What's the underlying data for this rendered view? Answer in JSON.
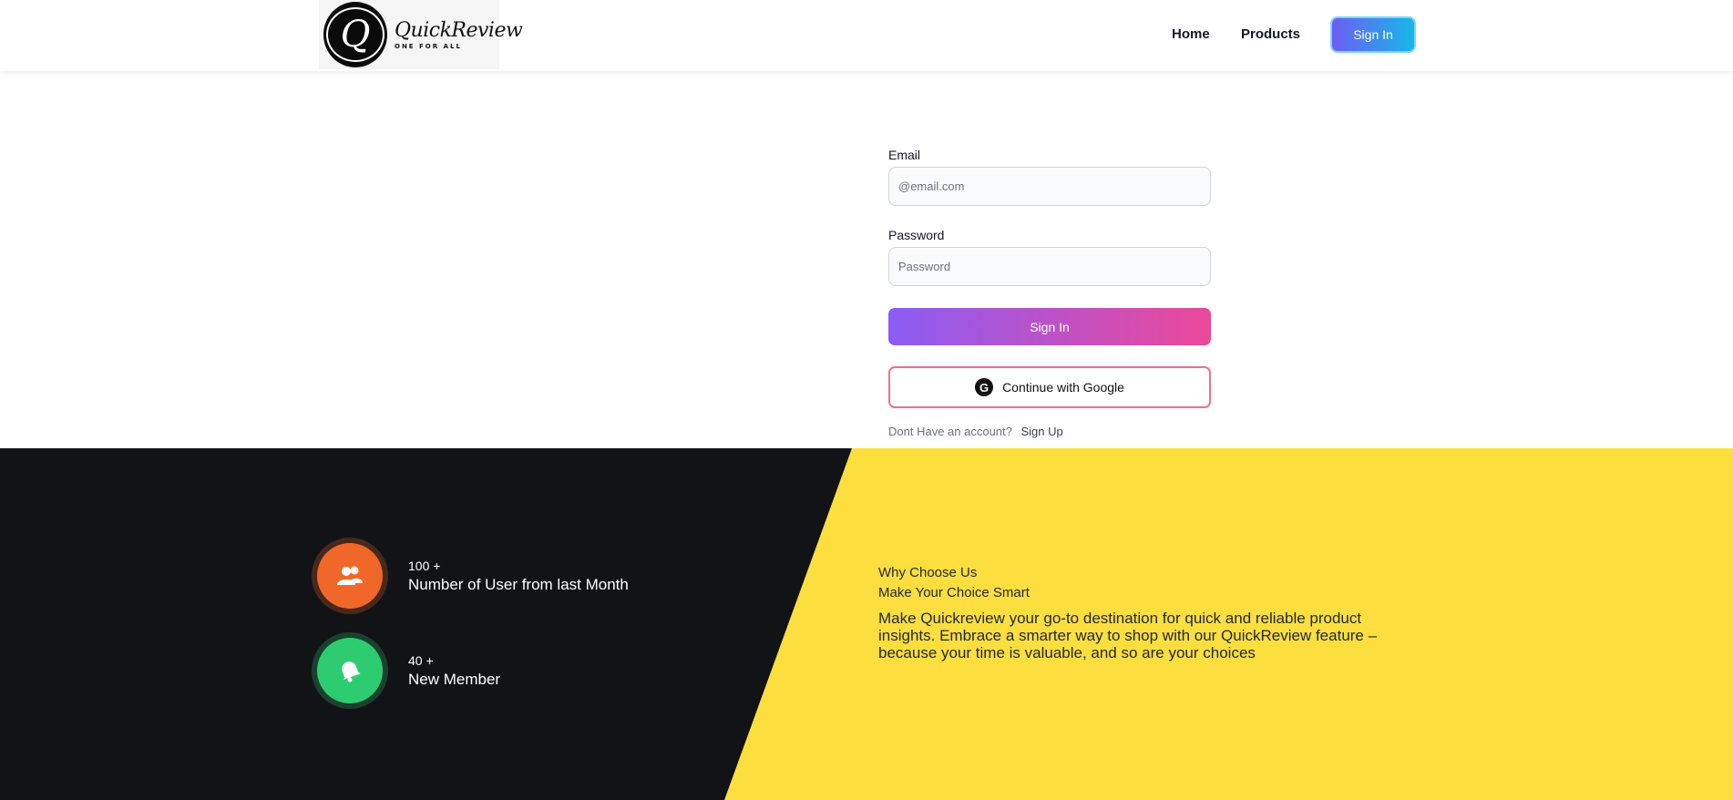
{
  "header": {
    "logo": {
      "title": "QuickReview",
      "tagline": "ONE FOR ALL",
      "letter": "Q"
    },
    "nav": {
      "home": "Home",
      "products": "Products",
      "sign_in": "Sign In"
    }
  },
  "form": {
    "email_label": "Email",
    "email_placeholder": "@email.com",
    "email_value": "",
    "password_label": "Password",
    "password_placeholder": "Password",
    "password_value": "",
    "sign_in_button": "Sign In",
    "google_button": "Continue with Google",
    "google_icon_letter": "G",
    "no_account_text": "Dont Have an account?",
    "sign_up_link": "Sign Up"
  },
  "stats": [
    {
      "number": "100  +",
      "label": "Number of User from last Month",
      "icon": "users-icon",
      "color": "#f0672a"
    },
    {
      "number": "40  +",
      "label": "New Member",
      "icon": "bell-icon",
      "color": "#2ecc71"
    }
  ],
  "why": {
    "eyebrow": "Why Choose Us",
    "title": "Make Your Choice Smart",
    "body": "Make Quickreview your go-to destination for quick and reliable product insights. Embrace a smarter way to shop with our QuickReview feature – because your time is valuable, and so are your choices"
  },
  "colors": {
    "dark_panel": "#121317",
    "yellow_panel": "#fdde3f",
    "accent_gradient_start": "#8b5cf6",
    "accent_gradient_end": "#ec4899"
  }
}
